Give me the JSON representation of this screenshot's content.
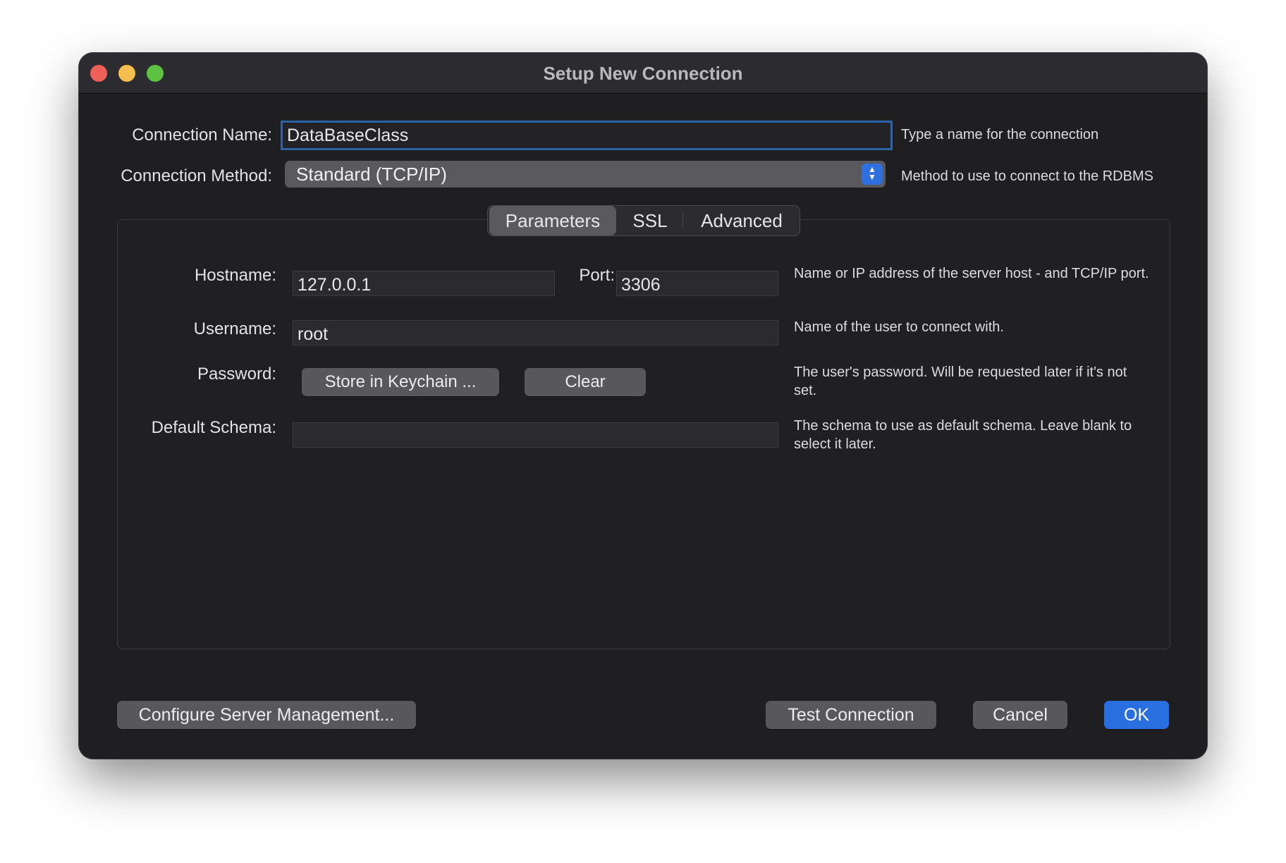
{
  "window": {
    "title": "Setup New Connection"
  },
  "connection": {
    "name_label": "Connection Name:",
    "name_value": "DataBaseClass",
    "name_hint": "Type a name for the connection",
    "method_label": "Connection Method:",
    "method_value": "Standard (TCP/IP)",
    "method_hint": "Method to use to connect to the RDBMS"
  },
  "tabs": [
    {
      "label": "Parameters",
      "active": true
    },
    {
      "label": "SSL",
      "active": false
    },
    {
      "label": "Advanced",
      "active": false
    }
  ],
  "parameters": {
    "hostname_label": "Hostname:",
    "hostname_value": "127.0.0.1",
    "port_label": "Port:",
    "port_value": "3306",
    "host_hint": "Name or IP address of the server host - and TCP/IP port.",
    "username_label": "Username:",
    "username_value": "root",
    "username_hint": "Name of the user to connect with.",
    "password_label": "Password:",
    "store_keychain_button": "Store in Keychain ...",
    "clear_button": "Clear",
    "password_hint": "The user's password. Will be requested later if it's not set.",
    "schema_label": "Default Schema:",
    "schema_value": "",
    "schema_hint": "The schema to use as default schema. Leave blank to select it later."
  },
  "footer": {
    "configure_button": "Configure Server Management...",
    "test_button": "Test Connection",
    "cancel_button": "Cancel",
    "ok_button": "OK"
  },
  "colors": {
    "accent": "#2a6fe0",
    "window_bg": "#1f1f22",
    "focus_ring": "#2d64a8"
  }
}
